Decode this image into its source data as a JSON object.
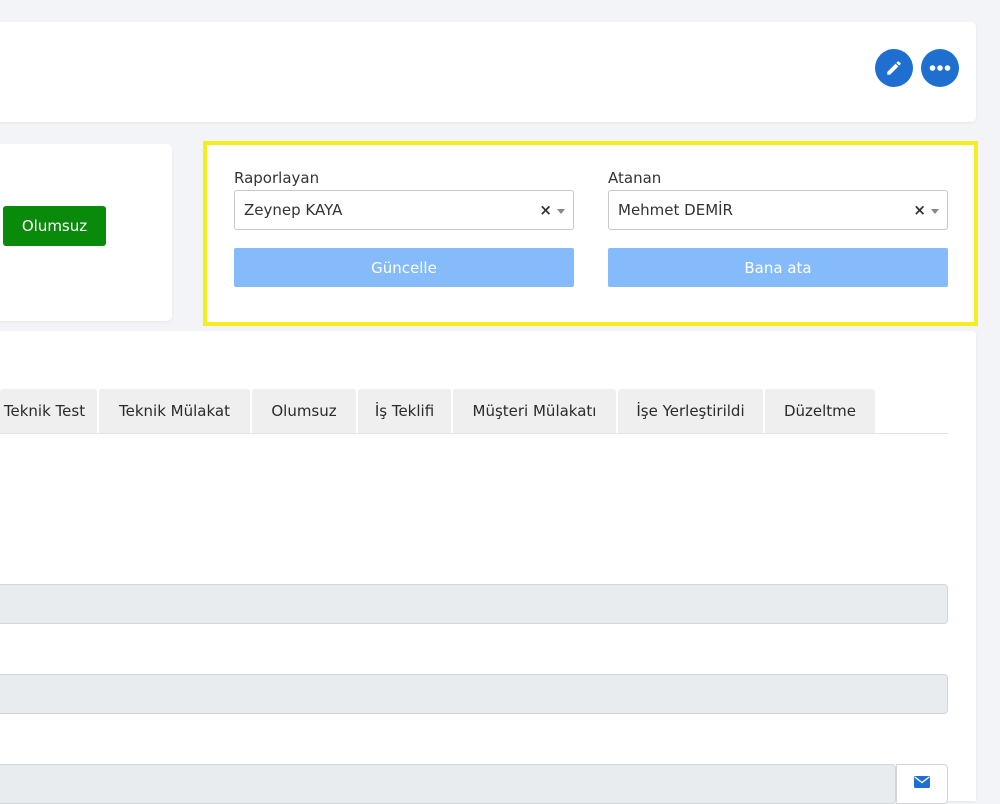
{
  "header": {
    "edit_icon": "pencil-icon",
    "more_icon": "ellipsis-icon"
  },
  "status": {
    "reject_label": "Olumsuz",
    "reject_color": "#0a8a0a"
  },
  "assignment": {
    "reporter_label": "Raporlayan",
    "reporter_value": "Zeynep KAYA",
    "assignee_label": "Atanan",
    "assignee_value": "Mehmet DEMİR",
    "clear_symbol": "×",
    "update_label": "Güncelle",
    "assign_me_label": "Bana ata",
    "button_color": "#85bbfb",
    "highlight_color": "#f5ee1e"
  },
  "tabs": [
    {
      "label": "Teknik Test"
    },
    {
      "label": "Teknik Mülakat"
    },
    {
      "label": "Olumsuz"
    },
    {
      "label": "İş Teklifi"
    },
    {
      "label": "Müşteri Mülakatı"
    },
    {
      "label": "İşe Yerleştirildi"
    },
    {
      "label": "Düzeltme"
    }
  ],
  "form": {
    "email_icon": "envelope-icon"
  },
  "colors": {
    "accent": "#1f6fd0"
  }
}
